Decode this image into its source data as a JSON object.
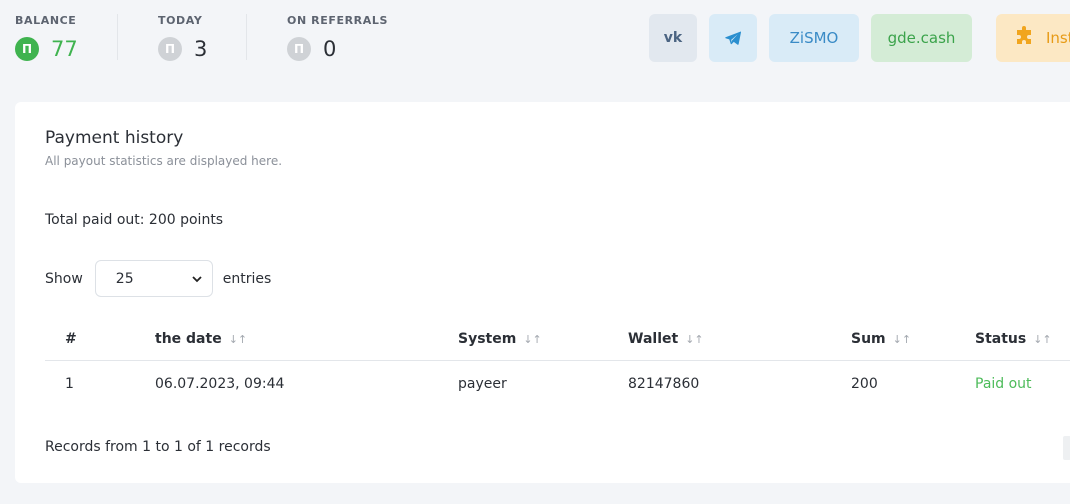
{
  "stats": {
    "balance": {
      "label": "BALANCE",
      "icon": "П",
      "value": "77"
    },
    "today": {
      "label": "TODAY",
      "icon": "П",
      "value": "3"
    },
    "referrals": {
      "label": "ON REFERRALS",
      "icon": "П",
      "value": "0"
    }
  },
  "top_buttons": {
    "vk": "vk",
    "telegram_icon": "telegram-icon",
    "zismo": "ZiSMO",
    "gdecash": "gde.cash",
    "inst": "Inst"
  },
  "card": {
    "title": "Payment history",
    "subtitle": "All payout statistics are displayed here.",
    "total": "Total paid out: 200 points",
    "show_label": "Show",
    "entries_value": "25",
    "entries_label": "entries",
    "sort_glyph": "↓↑",
    "columns": {
      "num": "#",
      "date": "the date",
      "system": "System",
      "wallet": "Wallet",
      "sum": "Sum",
      "status": "Status"
    },
    "rows": [
      {
        "num": "1",
        "date": "06.07.2023, 09:44",
        "system": "payeer",
        "wallet": "82147860",
        "sum": "200",
        "status": "Paid out"
      }
    ],
    "footer": "Records from 1 to 1 of 1 records"
  },
  "colors": {
    "accent_green": "#3fb34f",
    "status_green": "#4dbb5a"
  }
}
